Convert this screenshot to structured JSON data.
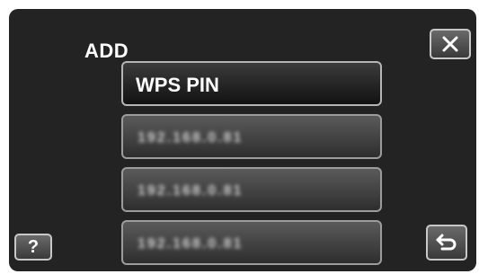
{
  "header": {
    "title": "ADD",
    "close_icon": "close-icon"
  },
  "list": {
    "items": [
      {
        "label": "WPS PIN"
      },
      {
        "label": "192.168.0.81"
      },
      {
        "label": "192.168.0.81"
      },
      {
        "label": "192.168.0.81"
      }
    ]
  },
  "footer": {
    "help_label": "?",
    "help_icon": "help-icon",
    "back_icon": "return-icon"
  },
  "colors": {
    "screen_bg": "#232323",
    "button_border": "#9c9c9c",
    "text": "#ffffff"
  }
}
